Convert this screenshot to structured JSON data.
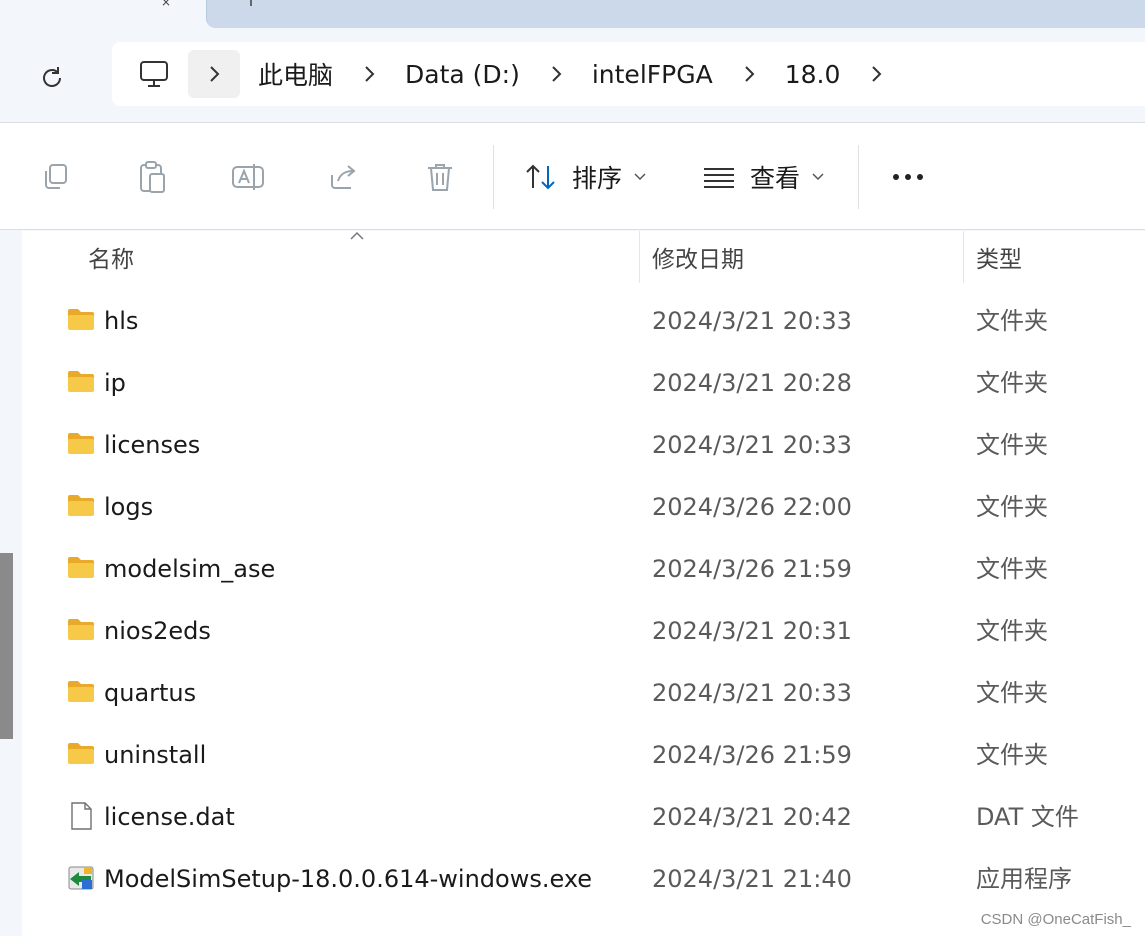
{
  "breadcrumb": {
    "segments": [
      "此电脑",
      "Data (D:)",
      "intelFPGA",
      "18.0"
    ]
  },
  "toolbar": {
    "sort_label": "排序",
    "view_label": "查看"
  },
  "columns": {
    "name": "名称",
    "modified": "修改日期",
    "type": "类型"
  },
  "files": [
    {
      "name": "hls",
      "modified": "2024/3/21 20:33",
      "type": "文件夹",
      "icon": "folder-icon"
    },
    {
      "name": "ip",
      "modified": "2024/3/21 20:28",
      "type": "文件夹",
      "icon": "folder-icon"
    },
    {
      "name": "licenses",
      "modified": "2024/3/21 20:33",
      "type": "文件夹",
      "icon": "folder-icon"
    },
    {
      "name": "logs",
      "modified": "2024/3/26 22:00",
      "type": "文件夹",
      "icon": "folder-icon"
    },
    {
      "name": "modelsim_ase",
      "modified": "2024/3/26 21:59",
      "type": "文件夹",
      "icon": "folder-icon"
    },
    {
      "name": "nios2eds",
      "modified": "2024/3/21 20:31",
      "type": "文件夹",
      "icon": "folder-icon"
    },
    {
      "name": "quartus",
      "modified": "2024/3/21 20:33",
      "type": "文件夹",
      "icon": "folder-icon"
    },
    {
      "name": "uninstall",
      "modified": "2024/3/26 21:59",
      "type": "文件夹",
      "icon": "folder-icon"
    },
    {
      "name": "license.dat",
      "modified": "2024/3/21 20:42",
      "type": "DAT 文件",
      "icon": "file-icon"
    },
    {
      "name": "ModelSimSetup-18.0.0.614-windows.exe",
      "modified": "2024/3/21 21:40",
      "type": "应用程序",
      "icon": "installer-icon"
    }
  ],
  "watermark": "CSDN @OneCatFish_",
  "colors": {
    "folder": "#f7c948",
    "accent": "#0067c0"
  }
}
